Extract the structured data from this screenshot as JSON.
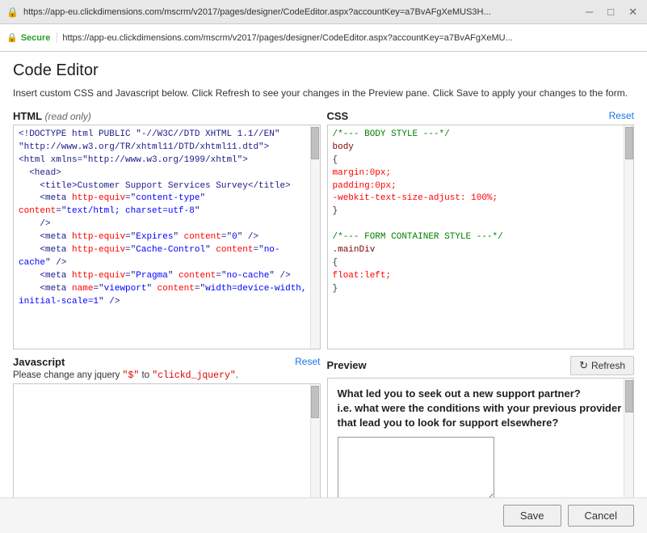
{
  "browser": {
    "title_url": "https://app-eu.clickdimensions.com/mscrm/v2017/pages/designer/CodeEditor.aspx?accountKey=a7BvAFgXeMUS3H...",
    "address_secure": "Secure",
    "address_url": "https://app-eu.clickdimensions.com/mscrm/v2017/pages/designer/CodeEditor.aspx?accountKey=a7BvAFgXeMU..."
  },
  "page": {
    "title": "Code Editor",
    "instruction": "Insert custom CSS and Javascript below. Click Refresh to see your changes in the Preview pane. Click Save to apply your changes to the form."
  },
  "html_section": {
    "title": "HTML",
    "readonly_label": "(read only)",
    "content": "<!DOCTYPE html PUBLIC \"-//W3C//DTD XHTML 1.1//EN\"\n\"http://www.w3.org/TR/xhtml11/DTD/xhtml11.dtd\">\n<html xmlns=\"http://www.w3.org/1999/xhtml\">\n  <head>\n    <title>Customer Support Services Survey</title>\n    <meta http-equiv=\"content-type\" content=\"text/html; charset=utf-8\"\n    />\n    <meta http-equiv=\"Expires\" content=\"0\" />\n    <meta http-equiv=\"Cache-Control\" content=\"no-cache\" />\n    <meta http-equiv=\"Pragma\" content=\"no-cache\" />\n    <meta name=\"viewport\" content=\"width=device-width, initial-scale=1\" />"
  },
  "css_section": {
    "title": "CSS",
    "reset_label": "Reset",
    "content_lines": [
      {
        "type": "comment",
        "text": "/*--- BODY STYLE ---*/"
      },
      {
        "type": "selector",
        "text": "body"
      },
      {
        "type": "brace",
        "text": "{"
      },
      {
        "type": "property",
        "text": "margin:0px;"
      },
      {
        "type": "property",
        "text": "padding:0px;"
      },
      {
        "type": "property",
        "text": "-webkit-text-size-adjust: 100%;"
      },
      {
        "type": "brace",
        "text": "}"
      },
      {
        "type": "blank",
        "text": ""
      },
      {
        "type": "comment",
        "text": "/*--- FORM CONTAINER STYLE ---*/"
      },
      {
        "type": "selector",
        "text": ".mainDiv"
      },
      {
        "type": "brace",
        "text": "{"
      },
      {
        "type": "property",
        "text": "float:left;"
      },
      {
        "type": "brace",
        "text": "}"
      }
    ]
  },
  "javascript_section": {
    "title": "Javascript",
    "reset_label": "Reset",
    "instruction": "Please change any jquery \"$\" to \"clickd_jquery\".",
    "content": ""
  },
  "preview_section": {
    "title": "Preview",
    "refresh_button": "Refresh",
    "preview_text": "What led you to seek out a new support partner?\ni.e. what were the conditions with your previous provider that lead you to look for support elsewhere?"
  },
  "toolbar": {
    "save_label": "Save",
    "cancel_label": "Cancel"
  }
}
